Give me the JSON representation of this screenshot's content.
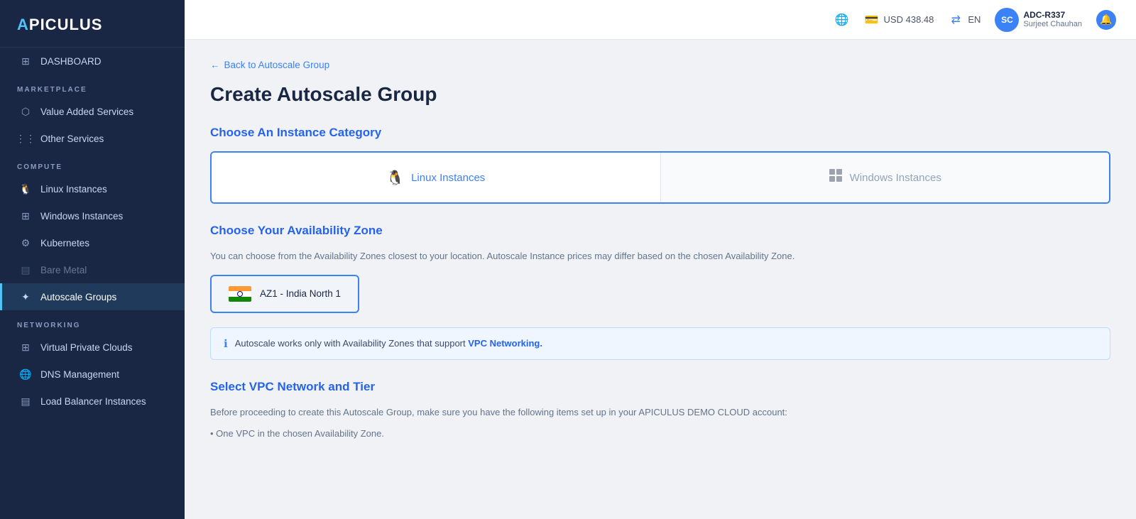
{
  "brand": {
    "logo_prefix": "■PICULUS",
    "logo_a": "A",
    "logo_text": "PICULUS"
  },
  "topbar": {
    "globe_icon": "🌐",
    "currency": "USD 438.48",
    "language": "EN",
    "user_initials": "SC",
    "user_name": "ADC-R337",
    "user_subtitle": "Surjeet Chauhan",
    "notif_icon": "🔔"
  },
  "sidebar": {
    "dashboard_label": "DASHBOARD",
    "marketplace_label": "MARKETPLACE",
    "value_added_services": "Value Added Services",
    "other_services": "Other Services",
    "compute_label": "COMPUTE",
    "linux_instances": "Linux Instances",
    "windows_instances": "Windows Instances",
    "kubernetes": "Kubernetes",
    "bare_metal": "Bare Metal",
    "autoscale_groups": "Autoscale Groups",
    "networking_label": "NETWORKING",
    "virtual_private_clouds": "Virtual Private Clouds",
    "dns_management": "DNS Management",
    "load_balancer_instances": "Load Balancer Instances"
  },
  "page": {
    "back_link": "← Back to Autoscale Group",
    "title": "Create Autoscale Group",
    "instance_category_title": "Choose An Instance Category",
    "linux_label": "Linux Instances",
    "windows_label": "Windows Instances",
    "availability_zone_title": "Choose Your Availability Zone",
    "az_description": "You can choose from the Availability Zones closest to your location. Autoscale Instance prices may differ based on the chosen Availability Zone.",
    "az_option": "AZ1 - India North 1",
    "info_banner_text": "Autoscale works only with Availability Zones that support ",
    "info_banner_link": "VPC Networking.",
    "vpc_network_title": "Select VPC Network and Tier",
    "vpc_description": "Before proceeding to create this Autoscale Group, make sure you have the following items set up in your APICULUS DEMO CLOUD account:",
    "vpc_bullet": "• One VPC in the chosen Availability Zone."
  }
}
